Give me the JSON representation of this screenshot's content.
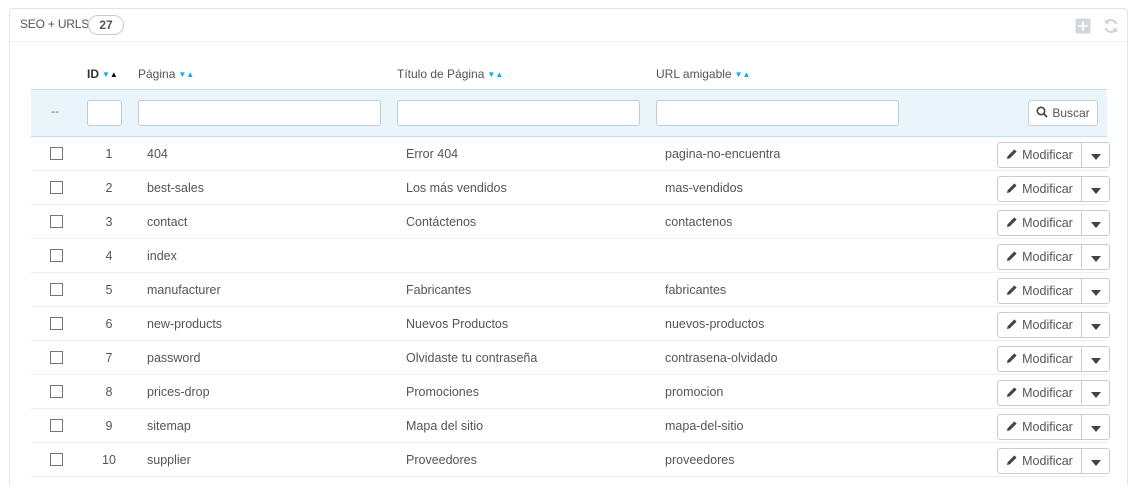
{
  "panel": {
    "title": "SEO + URLS",
    "count": "27",
    "icons": [
      "add-icon",
      "refresh-icon"
    ]
  },
  "columns": {
    "id": "ID",
    "page": "Página",
    "title": "Título de Página",
    "url": "URL amigable"
  },
  "filter": {
    "dash": "--",
    "search_label": "Buscar"
  },
  "row_action": {
    "edit_label": "Modificar"
  },
  "rows": [
    {
      "id": "1",
      "page": "404",
      "title": "Error 404",
      "url": "pagina-no-encuentra"
    },
    {
      "id": "2",
      "page": "best-sales",
      "title": "Los más vendidos",
      "url": "mas-vendidos"
    },
    {
      "id": "3",
      "page": "contact",
      "title": "Contáctenos",
      "url": "contactenos"
    },
    {
      "id": "4",
      "page": "index",
      "title": "",
      "url": ""
    },
    {
      "id": "5",
      "page": "manufacturer",
      "title": "Fabricantes",
      "url": "fabricantes"
    },
    {
      "id": "6",
      "page": "new-products",
      "title": "Nuevos Productos",
      "url": "nuevos-productos"
    },
    {
      "id": "7",
      "page": "password",
      "title": "Olvidaste tu contraseña",
      "url": "contrasena-olvidado"
    },
    {
      "id": "8",
      "page": "prices-drop",
      "title": "Promociones",
      "url": "promocion"
    },
    {
      "id": "9",
      "page": "sitemap",
      "title": "Mapa del sitio",
      "url": "mapa-del-sitio"
    },
    {
      "id": "10",
      "page": "supplier",
      "title": "Proveedores",
      "url": "proveedores"
    }
  ]
}
